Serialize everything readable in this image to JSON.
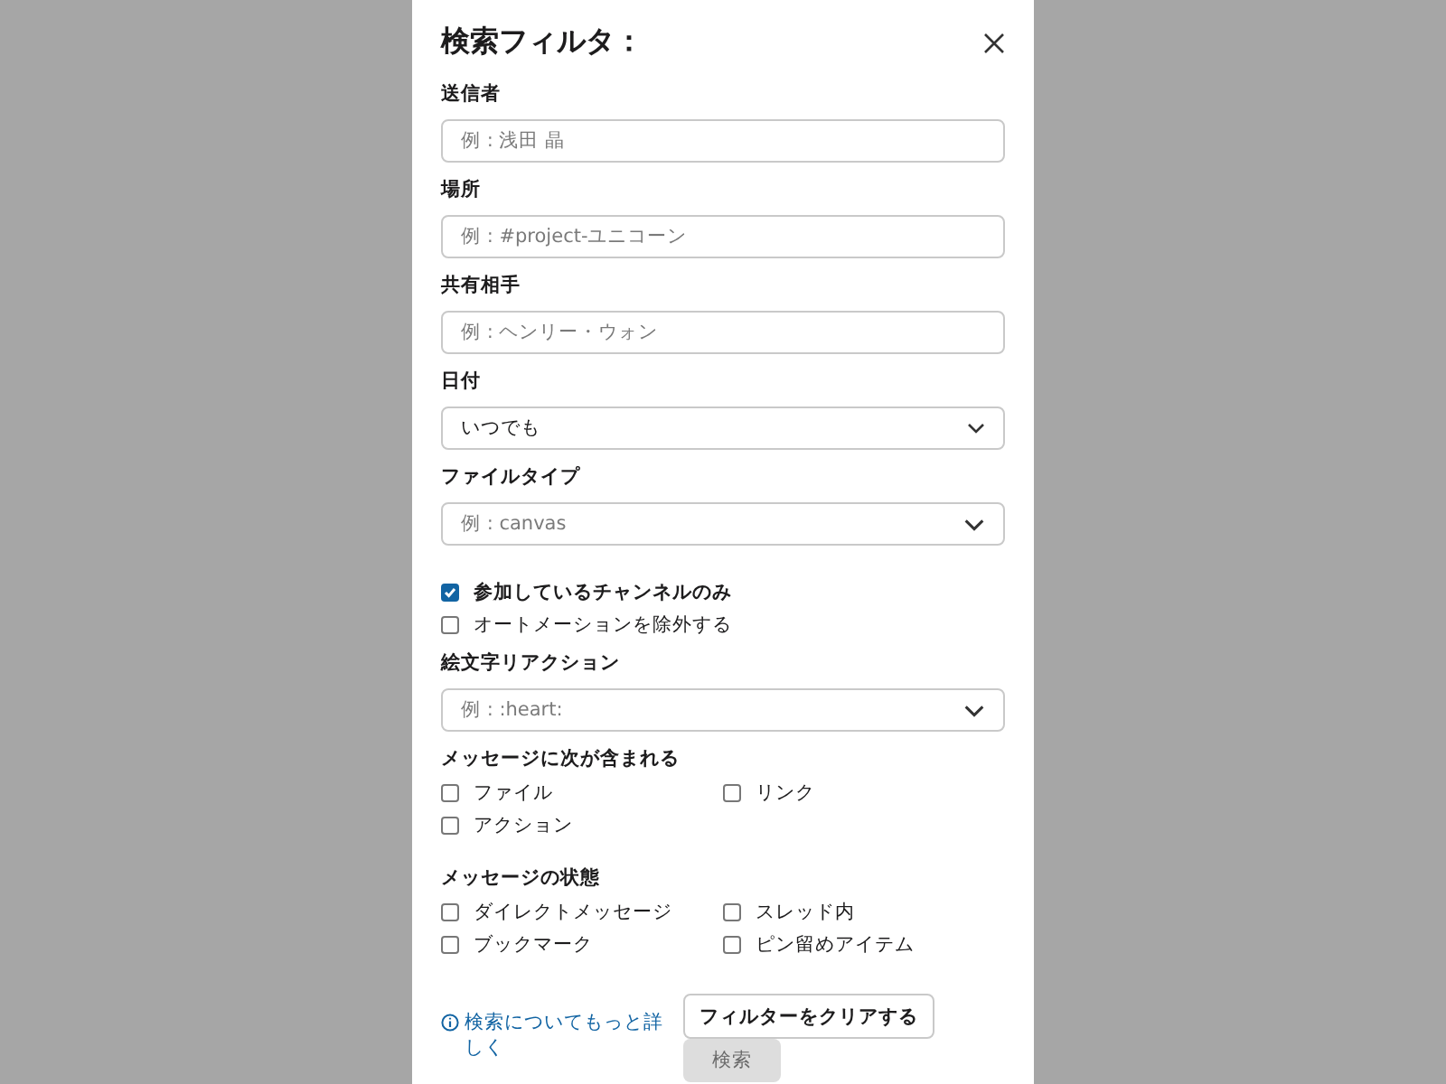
{
  "dialog": {
    "title": "検索フィルタ："
  },
  "fields": [
    {
      "kind": "text",
      "label": "送信者",
      "placeholder": "例 : 浅田 晶"
    },
    {
      "kind": "text",
      "label": "場所",
      "placeholder": "例 : #project-ユニコーン"
    },
    {
      "kind": "text",
      "label": "共有相手",
      "placeholder": "例 : ヘンリー・ウォン"
    },
    {
      "kind": "select",
      "label": "日付",
      "value": "いつでも"
    },
    {
      "kind": "combo",
      "label": "ファイルタイプ",
      "placeholder": "例 : canvas"
    }
  ],
  "toggles": [
    {
      "label": "参加しているチャンネルのみ",
      "checked": true
    },
    {
      "label": "オートメーションを除外する",
      "checked": false
    }
  ],
  "emoji_field": {
    "kind": "combo",
    "label": "絵文字リアクション",
    "placeholder": "例 : :heart:"
  },
  "sections": [
    {
      "title": "メッセージに次が含まれる",
      "options": [
        {
          "label": "ファイル",
          "checked": false
        },
        {
          "label": "リンク",
          "checked": false
        },
        {
          "label": "アクション",
          "checked": false
        }
      ]
    },
    {
      "title": "メッセージの状態",
      "options": [
        {
          "label": "ダイレクトメッセージ",
          "checked": false
        },
        {
          "label": "スレッド内",
          "checked": false
        },
        {
          "label": "ブックマーク",
          "checked": false
        },
        {
          "label": "ピン留めアイテム",
          "checked": false
        }
      ]
    }
  ],
  "footer": {
    "help_link": "検索についてもっと詳しく",
    "clear_button": "フィルターをクリアする",
    "search_button": {
      "label": "検索",
      "disabled": true
    }
  }
}
